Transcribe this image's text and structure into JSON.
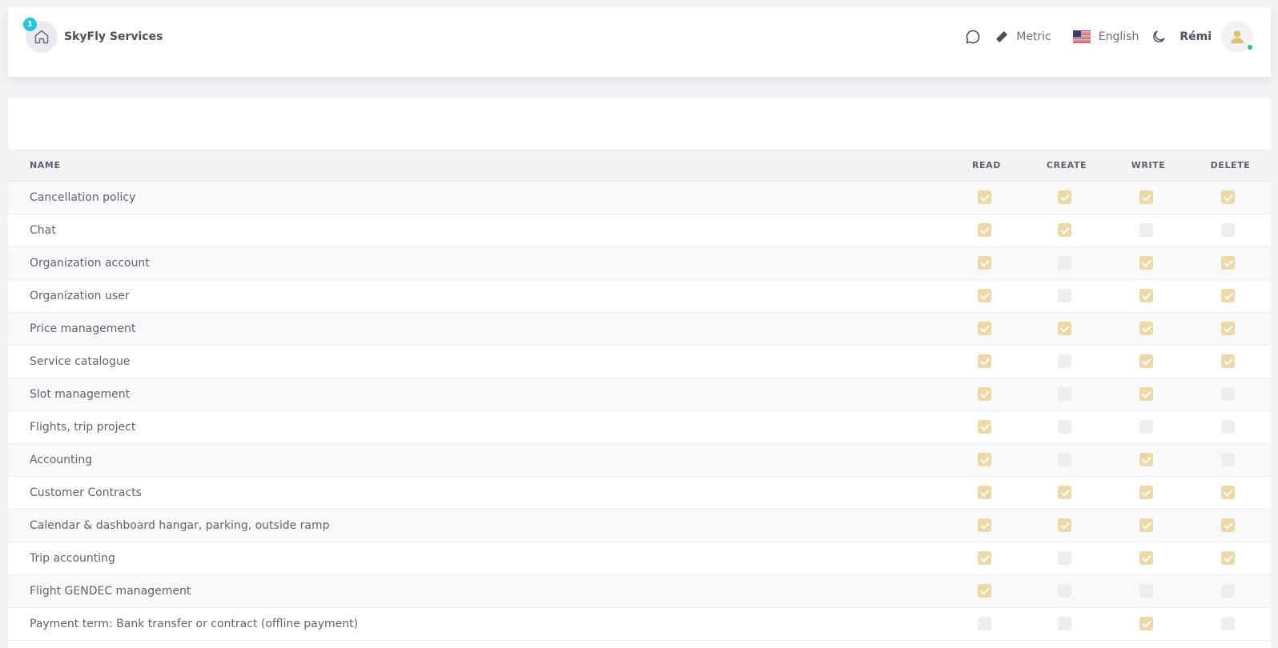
{
  "header": {
    "brand_name": "SkyFly Services",
    "notification_count": "1",
    "units_label": "Metric",
    "language_label": "English",
    "user_name": "Rémi",
    "accent_color": "#ecd9a6",
    "badge_color": "#22c7e1",
    "online_color": "#2ec36a"
  },
  "table": {
    "columns": [
      "NAME",
      "READ",
      "CREATE",
      "WRITE",
      "DELETE"
    ],
    "rows": [
      {
        "name": "Cancellation policy",
        "perms": [
          true,
          true,
          true,
          true
        ]
      },
      {
        "name": "Chat",
        "perms": [
          true,
          true,
          false,
          false
        ]
      },
      {
        "name": "Organization account",
        "perms": [
          true,
          false,
          true,
          true
        ]
      },
      {
        "name": "Organization user",
        "perms": [
          true,
          false,
          true,
          true
        ]
      },
      {
        "name": "Price management",
        "perms": [
          true,
          true,
          true,
          true
        ]
      },
      {
        "name": "Service catalogue",
        "perms": [
          true,
          false,
          true,
          true
        ]
      },
      {
        "name": "Slot management",
        "perms": [
          true,
          false,
          true,
          false
        ]
      },
      {
        "name": "Flights, trip project",
        "perms": [
          true,
          false,
          false,
          false
        ]
      },
      {
        "name": "Accounting",
        "perms": [
          true,
          false,
          true,
          false
        ]
      },
      {
        "name": "Customer Contracts",
        "perms": [
          true,
          true,
          true,
          true
        ]
      },
      {
        "name": "Calendar & dashboard hangar, parking, outside ramp",
        "perms": [
          true,
          true,
          true,
          true
        ]
      },
      {
        "name": "Trip accounting",
        "perms": [
          true,
          false,
          true,
          true
        ]
      },
      {
        "name": "Flight GENDEC management",
        "perms": [
          true,
          false,
          false,
          false
        ]
      },
      {
        "name": "Payment term: Bank transfer or contract (offline payment)",
        "perms": [
          false,
          false,
          true,
          false
        ]
      }
    ]
  }
}
